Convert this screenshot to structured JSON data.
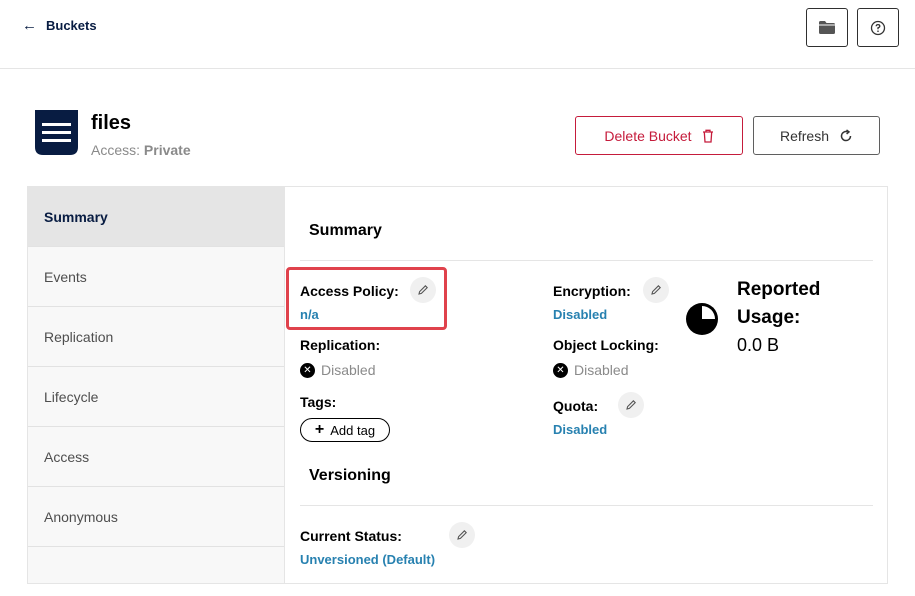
{
  "topbar": {
    "back_label": "Buckets"
  },
  "header": {
    "bucket_name": "files",
    "access_label": "Access:",
    "access_value": "Private",
    "delete_label": "Delete Bucket",
    "refresh_label": "Refresh"
  },
  "sidebar": {
    "items": [
      {
        "label": "Summary",
        "active": true
      },
      {
        "label": "Events"
      },
      {
        "label": "Replication"
      },
      {
        "label": "Lifecycle"
      },
      {
        "label": "Access"
      },
      {
        "label": "Anonymous"
      }
    ]
  },
  "summary": {
    "title": "Summary",
    "access_policy_label": "Access Policy:",
    "access_policy_value": "n/a",
    "replication_label": "Replication:",
    "replication_value": "Disabled",
    "tags_label": "Tags:",
    "add_tag_label": "Add tag",
    "encryption_label": "Encryption:",
    "encryption_value": "Disabled",
    "object_locking_label": "Object Locking:",
    "object_locking_value": "Disabled",
    "quota_label": "Quota:",
    "quota_value": "Disabled",
    "usage_label": "Reported Usage:",
    "usage_value": "0.0 B"
  },
  "versioning": {
    "title": "Versioning",
    "status_label": "Current Status:",
    "status_value": "Unversioned (Default)"
  },
  "colors": {
    "navy": "#081c42",
    "danger": "#c51b3b",
    "link": "#2781b0",
    "highlight": "#e0424c"
  }
}
